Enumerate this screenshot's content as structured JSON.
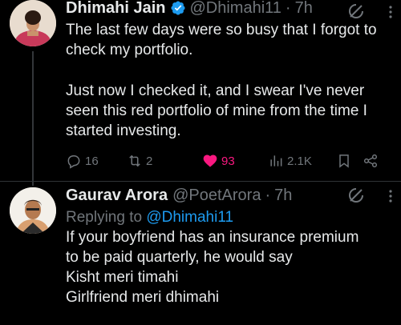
{
  "tweets": [
    {
      "name": "Dhimahi Jain",
      "handle": "@Dhimahi11",
      "dot": "·",
      "time": "7h",
      "body_lines": [
        "The last few days were so busy that I forgot to",
        "check my portfolio.",
        "",
        "Just now I checked it, and I swear I've never",
        "seen this red portfolio of mine from the time I",
        "started investing."
      ],
      "actions": {
        "replies": "16",
        "reposts": "2",
        "likes": "93",
        "views": "2.1K"
      }
    },
    {
      "name": "Gaurav Arora",
      "handle": "@PoetArora",
      "dot": "·",
      "time": "7h",
      "replying_prefix": "Replying to",
      "replying_to": "@Dhimahi11",
      "body_lines": [
        "If your boyfriend has an insurance premium",
        "to be paid quarterly, he would say",
        "Kisht meri timahi",
        "Girlfriend meri dhimahi"
      ]
    }
  ],
  "colors": {
    "background": "#000000",
    "text": "#e7e9ea",
    "muted": "#71767b",
    "accent": "#1d9bf0",
    "like": "#f91880"
  },
  "icons": [
    "verified-badge-icon",
    "grok-icon",
    "more-icon",
    "reply-icon",
    "retweet-icon",
    "like-icon",
    "views-icon",
    "bookmark-icon",
    "share-icon"
  ]
}
